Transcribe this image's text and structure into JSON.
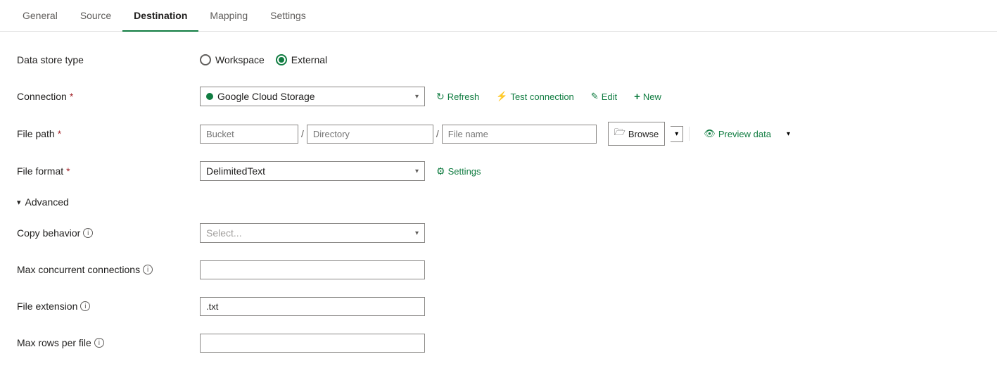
{
  "tabs": [
    {
      "id": "general",
      "label": "General",
      "active": false
    },
    {
      "id": "source",
      "label": "Source",
      "active": false
    },
    {
      "id": "destination",
      "label": "Destination",
      "active": true
    },
    {
      "id": "mapping",
      "label": "Mapping",
      "active": false
    },
    {
      "id": "settings",
      "label": "Settings",
      "active": false
    }
  ],
  "form": {
    "dataStoreType": {
      "label": "Data store type",
      "options": [
        {
          "id": "workspace",
          "label": "Workspace",
          "checked": false
        },
        {
          "id": "external",
          "label": "External",
          "checked": true
        }
      ]
    },
    "connection": {
      "label": "Connection",
      "required": true,
      "value": "Google Cloud Storage",
      "placeholder": "Google Cloud Storage",
      "actions": {
        "refresh": "Refresh",
        "testConnection": "Test connection",
        "edit": "Edit",
        "new": "New"
      }
    },
    "filePath": {
      "label": "File path",
      "required": true,
      "bucket": {
        "placeholder": "Bucket",
        "value": ""
      },
      "directory": {
        "placeholder": "Directory",
        "value": ""
      },
      "filename": {
        "placeholder": "File name",
        "value": ""
      },
      "browse": "Browse",
      "previewData": "Preview data"
    },
    "fileFormat": {
      "label": "File format",
      "required": true,
      "value": "DelimitedText",
      "settings": "Settings"
    },
    "advanced": {
      "label": "Advanced"
    },
    "copyBehavior": {
      "label": "Copy behavior",
      "placeholder": "Select...",
      "value": ""
    },
    "maxConcurrentConnections": {
      "label": "Max concurrent connections",
      "value": ""
    },
    "fileExtension": {
      "label": "File extension",
      "value": ".txt"
    },
    "maxRowsPerFile": {
      "label": "Max rows per file",
      "value": ""
    }
  },
  "colors": {
    "accent": "#107c41",
    "required": "#a4262c",
    "border": "#8a8886",
    "text": "#201f1e",
    "muted": "#605e5c"
  }
}
